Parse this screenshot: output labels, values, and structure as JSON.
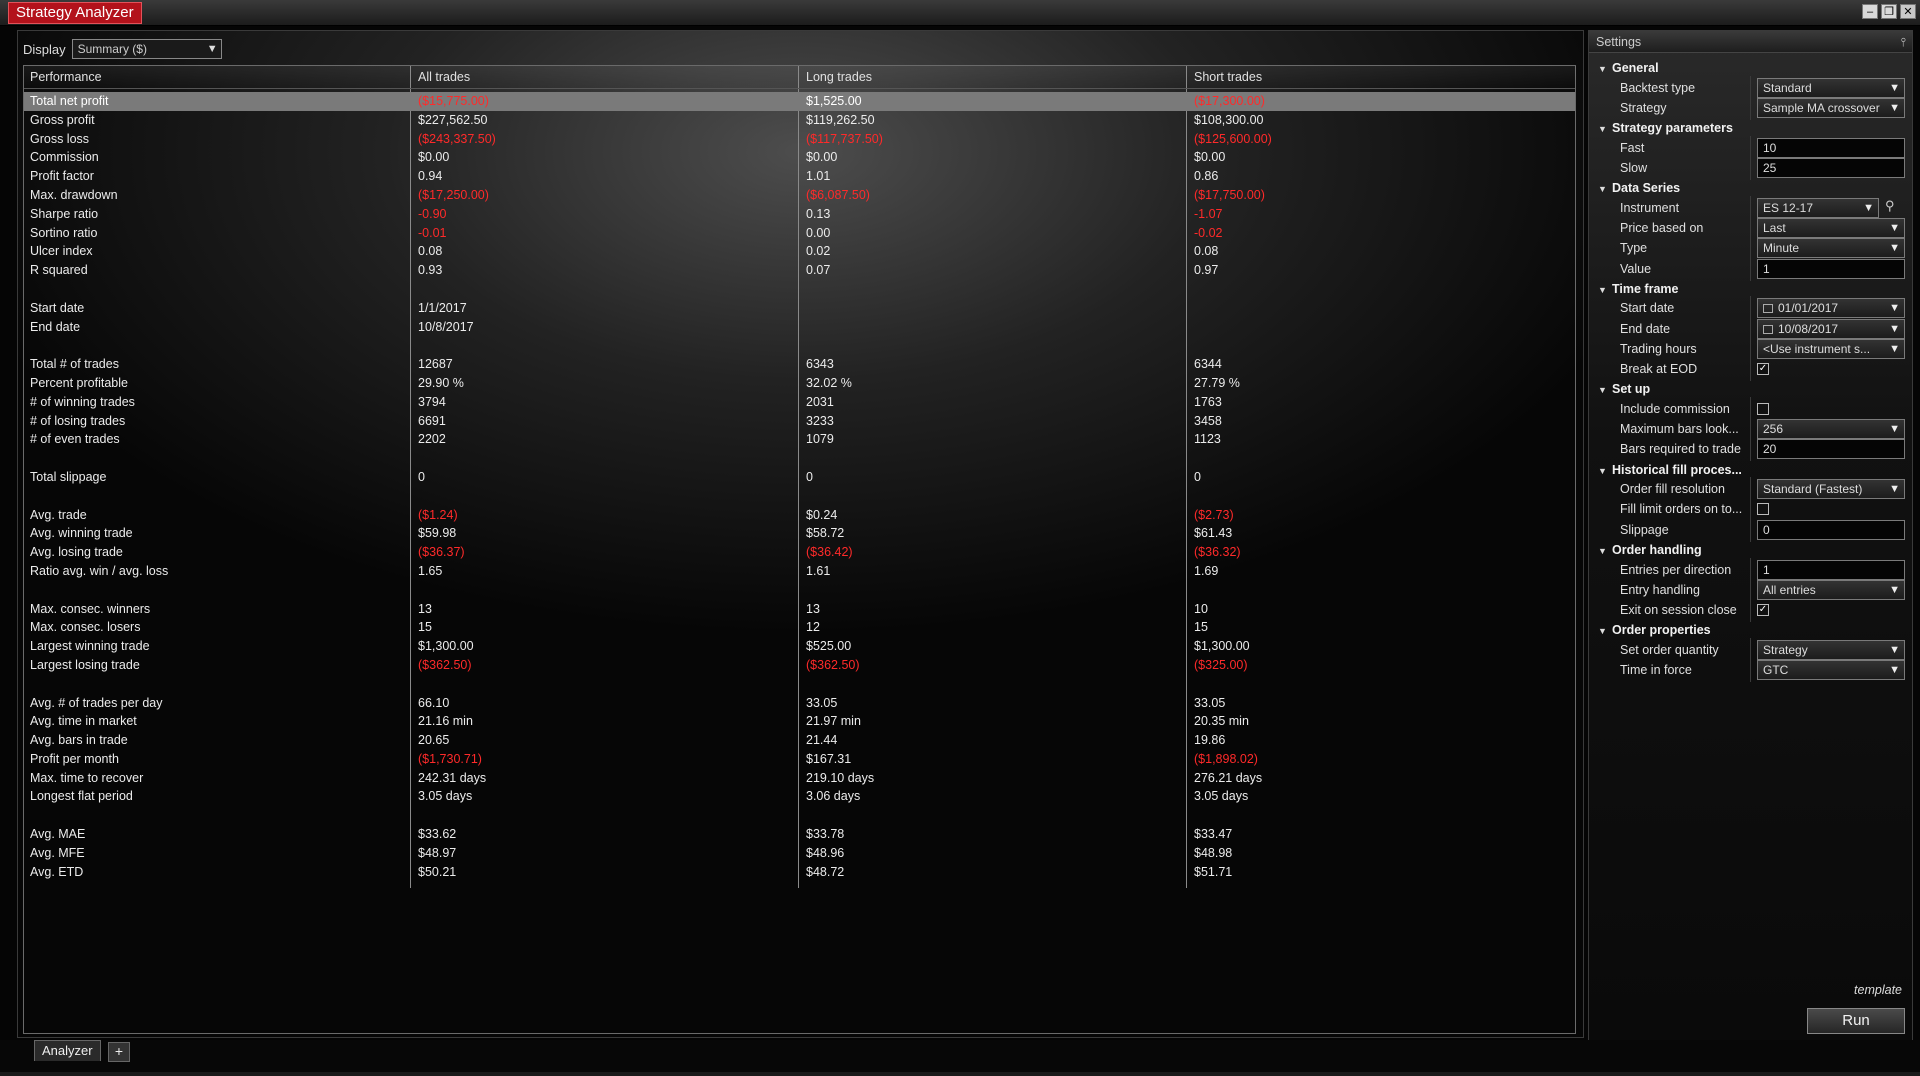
{
  "window": {
    "title": "Strategy Analyzer"
  },
  "display": {
    "label": "Display",
    "value": "Summary ($)"
  },
  "grid": {
    "columns": [
      "Performance",
      "All trades",
      "Long trades",
      "Short trades"
    ],
    "rows": [
      {
        "label": "Total net profit",
        "all": "($15,775.00)",
        "long": "$1,525.00",
        "short": "($17,300.00)",
        "selected": true
      },
      {
        "label": "Gross profit",
        "all": "$227,562.50",
        "long": "$119,262.50",
        "short": "$108,300.00"
      },
      {
        "label": "Gross loss",
        "all": "($243,337.50)",
        "long": "($117,737.50)",
        "short": "($125,600.00)"
      },
      {
        "label": "Commission",
        "all": "$0.00",
        "long": "$0.00",
        "short": "$0.00"
      },
      {
        "label": "Profit factor",
        "all": "0.94",
        "long": "1.01",
        "short": "0.86"
      },
      {
        "label": "Max. drawdown",
        "all": "($17,250.00)",
        "long": "($6,087.50)",
        "short": "($17,750.00)"
      },
      {
        "label": "Sharpe ratio",
        "all": "-0.90",
        "long": "0.13",
        "short": "-1.07"
      },
      {
        "label": "Sortino ratio",
        "all": "-0.01",
        "long": "0.00",
        "short": "-0.02"
      },
      {
        "label": "Ulcer index",
        "all": "0.08",
        "long": "0.02",
        "short": "0.08"
      },
      {
        "label": "R squared",
        "all": "0.93",
        "long": "0.07",
        "short": "0.97"
      },
      {
        "label": "",
        "all": "",
        "long": "",
        "short": ""
      },
      {
        "label": "Start date",
        "all": "1/1/2017",
        "long": "",
        "short": ""
      },
      {
        "label": "End date",
        "all": "10/8/2017",
        "long": "",
        "short": ""
      },
      {
        "label": "",
        "all": "",
        "long": "",
        "short": ""
      },
      {
        "label": "Total # of trades",
        "all": "12687",
        "long": "6343",
        "short": "6344"
      },
      {
        "label": "Percent profitable",
        "all": "29.90 %",
        "long": "32.02 %",
        "short": "27.79 %"
      },
      {
        "label": "# of winning trades",
        "all": "3794",
        "long": "2031",
        "short": "1763"
      },
      {
        "label": "# of losing trades",
        "all": "6691",
        "long": "3233",
        "short": "3458"
      },
      {
        "label": "# of even trades",
        "all": "2202",
        "long": "1079",
        "short": "1123"
      },
      {
        "label": "",
        "all": "",
        "long": "",
        "short": ""
      },
      {
        "label": "Total slippage",
        "all": "0",
        "long": "0",
        "short": "0"
      },
      {
        "label": "",
        "all": "",
        "long": "",
        "short": ""
      },
      {
        "label": "Avg. trade",
        "all": "($1.24)",
        "long": "$0.24",
        "short": "($2.73)"
      },
      {
        "label": "Avg. winning trade",
        "all": "$59.98",
        "long": "$58.72",
        "short": "$61.43"
      },
      {
        "label": "Avg. losing trade",
        "all": "($36.37)",
        "long": "($36.42)",
        "short": "($36.32)"
      },
      {
        "label": "Ratio avg. win / avg. loss",
        "all": "1.65",
        "long": "1.61",
        "short": "1.69"
      },
      {
        "label": "",
        "all": "",
        "long": "",
        "short": ""
      },
      {
        "label": "Max. consec. winners",
        "all": "13",
        "long": "13",
        "short": "10"
      },
      {
        "label": "Max. consec. losers",
        "all": "15",
        "long": "12",
        "short": "15"
      },
      {
        "label": "Largest winning trade",
        "all": "$1,300.00",
        "long": "$525.00",
        "short": "$1,300.00"
      },
      {
        "label": "Largest losing trade",
        "all": "($362.50)",
        "long": "($362.50)",
        "short": "($325.00)"
      },
      {
        "label": "",
        "all": "",
        "long": "",
        "short": ""
      },
      {
        "label": "Avg. # of trades per day",
        "all": "66.10",
        "long": "33.05",
        "short": "33.05"
      },
      {
        "label": "Avg. time in market",
        "all": "21.16 min",
        "long": "21.97 min",
        "short": "20.35 min"
      },
      {
        "label": "Avg. bars in trade",
        "all": "20.65",
        "long": "21.44",
        "short": "19.86"
      },
      {
        "label": "Profit per month",
        "all": "($1,730.71)",
        "long": "$167.31",
        "short": "($1,898.02)"
      },
      {
        "label": "Max. time to recover",
        "all": "242.31 days",
        "long": "219.10 days",
        "short": "276.21 days"
      },
      {
        "label": "Longest flat period",
        "all": "3.05 days",
        "long": "3.06 days",
        "short": "3.05 days"
      },
      {
        "label": "",
        "all": "",
        "long": "",
        "short": ""
      },
      {
        "label": "Avg. MAE",
        "all": "$33.62",
        "long": "$33.78",
        "short": "$33.47"
      },
      {
        "label": "Avg. MFE",
        "all": "$48.97",
        "long": "$48.96",
        "short": "$48.98"
      },
      {
        "label": "Avg. ETD",
        "all": "$50.21",
        "long": "$48.72",
        "short": "$51.71"
      }
    ]
  },
  "settings": {
    "title": "Settings",
    "rows": [
      {
        "kind": "category",
        "label": "General"
      },
      {
        "kind": "select",
        "label": "Backtest type",
        "value": "Standard"
      },
      {
        "kind": "select",
        "label": "Strategy",
        "value": "Sample MA crossover"
      },
      {
        "kind": "category",
        "label": "Strategy parameters"
      },
      {
        "kind": "text",
        "label": "Fast",
        "value": "10"
      },
      {
        "kind": "text",
        "label": "Slow",
        "value": "25"
      },
      {
        "kind": "category",
        "label": "Data Series"
      },
      {
        "kind": "instrument",
        "label": "Instrument",
        "value": "ES 12-17"
      },
      {
        "kind": "select",
        "label": "Price based on",
        "value": "Last"
      },
      {
        "kind": "select",
        "label": "Type",
        "value": "Minute"
      },
      {
        "kind": "text",
        "label": "Value",
        "value": "1"
      },
      {
        "kind": "category",
        "label": "Time frame"
      },
      {
        "kind": "date",
        "label": "Start date",
        "value": "01/01/2017"
      },
      {
        "kind": "date",
        "label": "End date",
        "value": "10/08/2017"
      },
      {
        "kind": "select",
        "label": "Trading hours",
        "value": "<Use instrument s..."
      },
      {
        "kind": "check",
        "label": "Break at EOD",
        "checked": true
      },
      {
        "kind": "category",
        "label": "Set up"
      },
      {
        "kind": "check",
        "label": "Include commission",
        "checked": false
      },
      {
        "kind": "select",
        "label": "Maximum bars look...",
        "value": "256"
      },
      {
        "kind": "text",
        "label": "Bars required to trade",
        "value": "20"
      },
      {
        "kind": "category",
        "label": "Historical fill proces..."
      },
      {
        "kind": "select",
        "label": "Order fill resolution",
        "value": "Standard (Fastest)"
      },
      {
        "kind": "check",
        "label": "Fill limit orders on to...",
        "checked": false
      },
      {
        "kind": "text",
        "label": "Slippage",
        "value": "0"
      },
      {
        "kind": "category",
        "label": "Order handling"
      },
      {
        "kind": "text",
        "label": "Entries per direction",
        "value": "1"
      },
      {
        "kind": "select",
        "label": "Entry handling",
        "value": "All entries"
      },
      {
        "kind": "check",
        "label": "Exit on session close",
        "checked": true
      },
      {
        "kind": "category",
        "label": "Order properties"
      },
      {
        "kind": "select",
        "label": "Set order quantity",
        "value": "Strategy"
      },
      {
        "kind": "select",
        "label": "Time in force",
        "value": "GTC"
      }
    ],
    "template_label": "template",
    "run_label": "Run"
  },
  "tabs": {
    "active": "Analyzer",
    "add": "+"
  },
  "colors": {
    "negative": "#ff2a2a",
    "title_accent": "#b3121b",
    "selected_row": "#7a7a7a"
  }
}
